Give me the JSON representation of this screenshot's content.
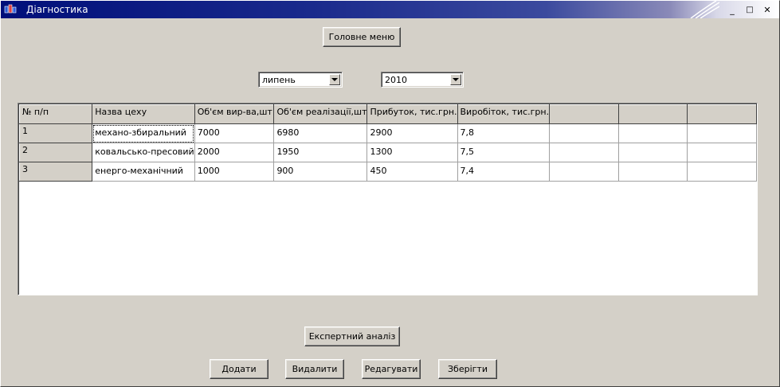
{
  "window": {
    "title": "Діагностика",
    "controls": {
      "minimize": "_",
      "maximize": "□",
      "close": "✕"
    }
  },
  "toolbar": {
    "main_menu_label": "Головне меню"
  },
  "filters": {
    "month": {
      "value": "липень",
      "icon": "chevron-down-icon"
    },
    "year": {
      "value": "2010",
      "icon": "chevron-down-icon"
    }
  },
  "table": {
    "headers": [
      "№ п/п",
      "Назва цеху",
      "Об'єм вир-ва,шт",
      "Об'єм реалізації,шт",
      "Прибуток, тис.грн.",
      "Виробіток, тис.грн.",
      "",
      "",
      ""
    ],
    "rows": [
      [
        "1",
        "механо-збиральний",
        "7000",
        "6980",
        "2900",
        "7,8",
        "",
        "",
        ""
      ],
      [
        "2",
        "ковальсько-пресовий",
        "2000",
        "1950",
        "1300",
        "7,5",
        "",
        "",
        ""
      ],
      [
        "3",
        "енерго-механічний",
        "1000",
        "900",
        "450",
        "7,4",
        "",
        "",
        ""
      ]
    ]
  },
  "actions": {
    "expert_label": "Експертний аналіз",
    "add_label": "Додати",
    "delete_label": "Видалити",
    "edit_label": "Редагувати",
    "save_label": "Зберігти"
  },
  "colors": {
    "titlebar_start": "#000f7a",
    "face": "#d4d0c8",
    "grid_bg": "#ffffff"
  }
}
